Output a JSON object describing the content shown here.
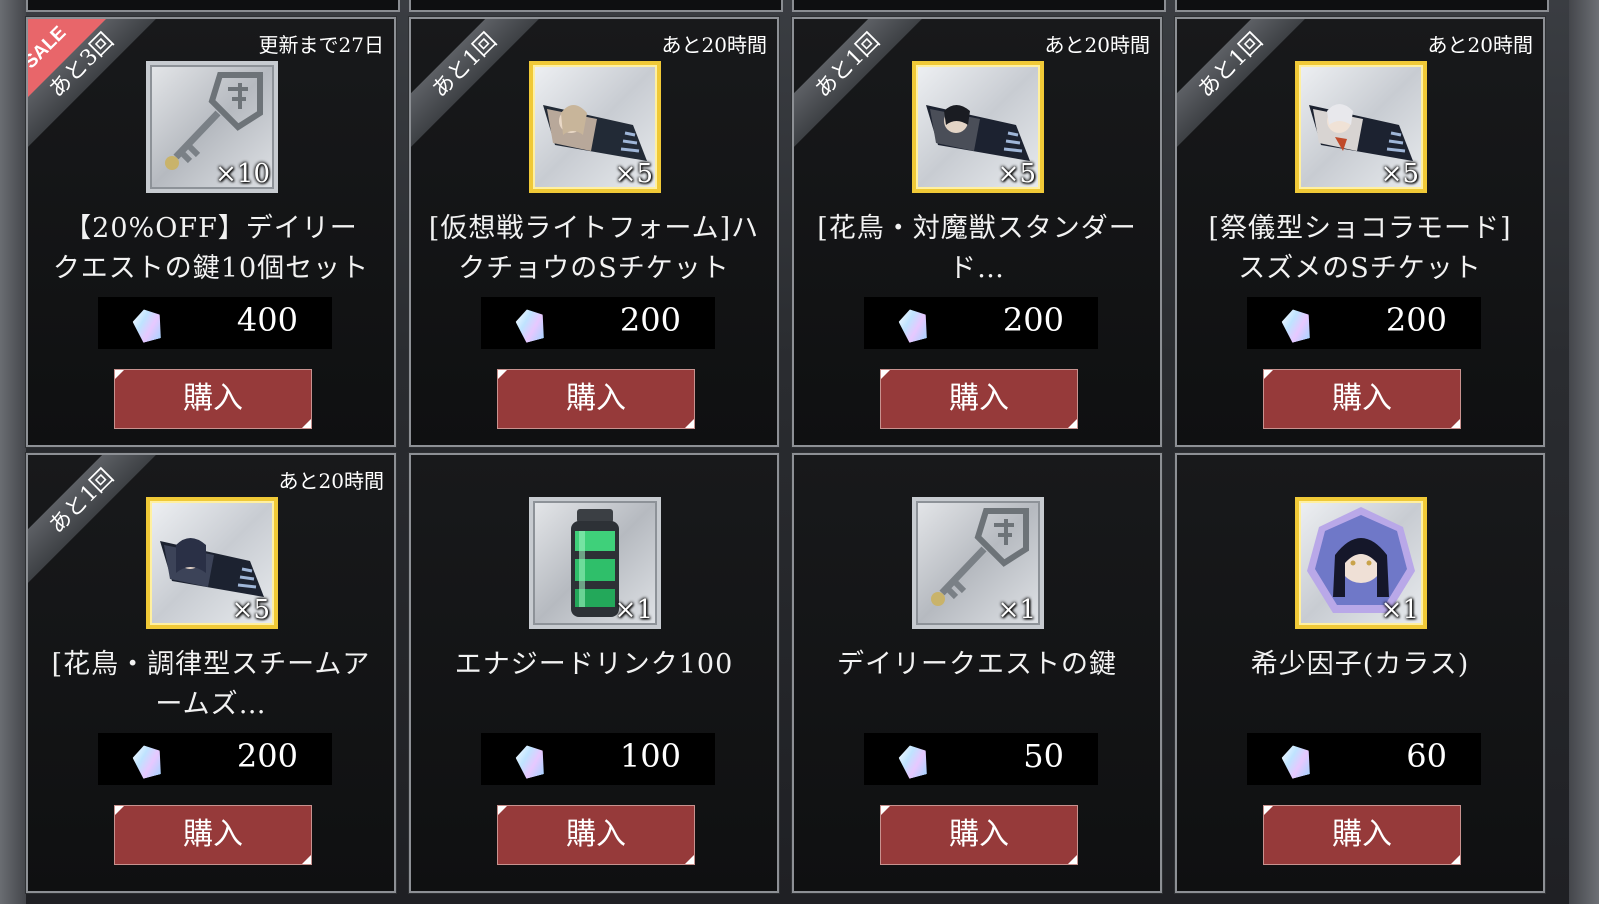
{
  "buy_label": "購入",
  "currency_icon": "crystal-gem-icon",
  "sale_badge": "SALE",
  "cards": [
    {
      "limit": "あと3回",
      "timer": "更新まで27日",
      "name": [
        "【20%OFF】デイリー",
        "クエストの鍵10個セット"
      ],
      "qty": "×10",
      "price": "400",
      "icon": "key-icon",
      "frame": "silver",
      "sale": true
    },
    {
      "limit": "あと1回",
      "timer": "あと20時間",
      "name": [
        "[仮想戦ライトフォーム]ハ",
        "クチョウのSチケット"
      ],
      "qty": "×5",
      "price": "200",
      "icon": "ticket-icon",
      "frame": "gold",
      "sale": false
    },
    {
      "limit": "あと1回",
      "timer": "あと20時間",
      "name": [
        "[花鳥・対魔獣スタンダー",
        "ド…"
      ],
      "qty": "×5",
      "price": "200",
      "icon": "ticket-icon",
      "frame": "gold",
      "sale": false
    },
    {
      "limit": "あと1回",
      "timer": "あと20時間",
      "name": [
        "[祭儀型ショコラモード]",
        "スズメのSチケット"
      ],
      "qty": "×5",
      "price": "200",
      "icon": "ticket-icon",
      "frame": "gold",
      "sale": false
    },
    {
      "limit": "あと1回",
      "timer": "あと20時間",
      "name": [
        "[花鳥・調律型スチームア",
        "ームズ…"
      ],
      "qty": "×5",
      "price": "200",
      "icon": "ticket-icon",
      "frame": "gold",
      "sale": false
    },
    {
      "limit": "",
      "timer": "",
      "name": [
        "エナジードリンク100"
      ],
      "qty": "×1",
      "price": "100",
      "icon": "energy-drink-icon",
      "frame": "silver",
      "sale": false
    },
    {
      "limit": "",
      "timer": "",
      "name": [
        "デイリークエストの鍵"
      ],
      "qty": "×1",
      "price": "50",
      "icon": "key-icon",
      "frame": "silver",
      "sale": false
    },
    {
      "limit": "",
      "timer": "",
      "name": [
        "希少因子(カラス)"
      ],
      "qty": "×1",
      "price": "60",
      "icon": "rare-factor-crystal-icon",
      "frame": "gold",
      "sale": false
    }
  ]
}
